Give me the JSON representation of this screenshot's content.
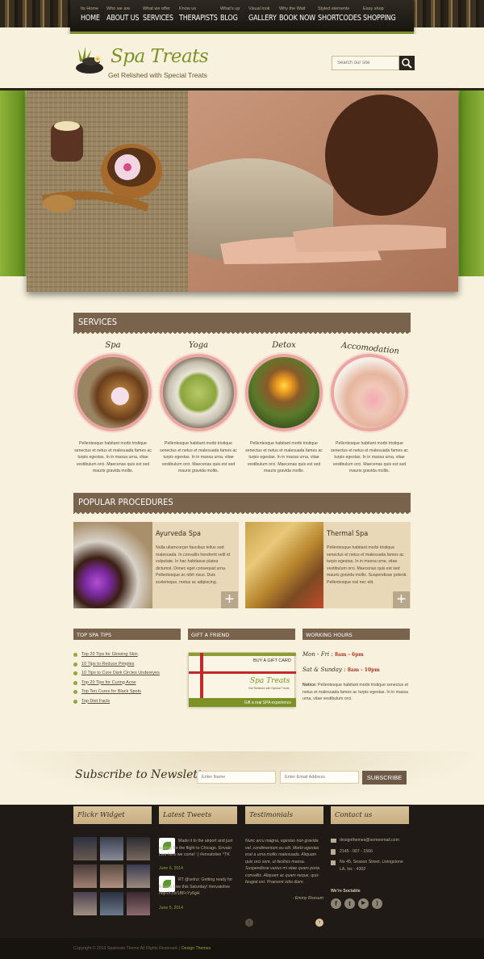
{
  "nav": [
    {
      "sub": "Its Home",
      "label": "HOME"
    },
    {
      "sub": "Who we are",
      "label": "ABOUT US"
    },
    {
      "sub": "What we offer",
      "label": "SERVICES"
    },
    {
      "sub": "Know us",
      "label": "THERAPISTS"
    },
    {
      "sub": "What's up",
      "label": "BLOG"
    },
    {
      "sub": "Visual look",
      "label": "GALLERY"
    },
    {
      "sub": "Why the Wait",
      "label": "BOOK NOW"
    },
    {
      "sub": "Styled elements",
      "label": "SHORTCODES"
    },
    {
      "sub": "Easy shop",
      "label": "SHOPPING"
    }
  ],
  "logo": {
    "title": "Spa Treats",
    "tagline": "Get Relished with Special Treats"
  },
  "search": {
    "placeholder": "Search our site"
  },
  "services": {
    "heading": "SERVICES",
    "items": [
      {
        "title": "Spa",
        "text": "Pellentesque habitant morbi tristique senectus et netus et malesuada fames ac turpis egestas. In in massa urna, vitae vestibulum orci. Maecenas quis est sed mauris gravida mollis."
      },
      {
        "title": "Yoga",
        "text": "Pellentesque habitant morbi tristique senectus et netus et malesuada fames ac turpis egestas. In in massa urna, vitae vestibulum orci. Maecenas quis est sed mauris gravida mollis."
      },
      {
        "title": "Detox",
        "text": "Pellentesque habitant morbi tristique senectus et netus et malesuada fames ac turpis egestas. In in massa urna, vitae vestibulum orci. Maecenas quis est sed mauris gravida mollis."
      },
      {
        "title": "Accomodation",
        "text": "Pellentesque habitant morbi tristique senectus et netus et malesuada fames ac turpis egestas. In in massa urna, vitae vestibulum orci. Maecenas quis est sed mauris gravida mollis."
      }
    ]
  },
  "procedures": {
    "heading": "POPULAR PROCEDURES",
    "items": [
      {
        "title": "Ayurveda Spa",
        "text": "Nulla ullamcorper faucibus tellus sed malesuada. In convallis hendrerit velit id vulputate. In hac habitasse platea dictumst. Donec eget consequat urna. Pellentesque ac nibh risus. Duis scelerisque, metus ac adipiscing."
      },
      {
        "title": "Thermal Spa",
        "text": "Pellentesque habitant morbi tristique senectus et netus et malesuada fames ac turpis egestas. In in massa urna, vitae vestibulum orci. Maecenas quis est sed mauris gravida mollis. Suspendisse potenti. Pellentesque nisl nec elit."
      }
    ]
  },
  "tips": {
    "heading": "TOP SPA TIPS",
    "items": [
      "Top 20 Tips for Glowing Skin",
      "10 Tips to Reduce Pimples",
      "10 Tips to Cure Dark Circles Undereyes",
      "Top 20 Tips for Curing Acne",
      "Top Ten Cures for Black Spots",
      "Top Diet Facts"
    ]
  },
  "gift": {
    "heading": "GIFT A FRIEND",
    "card_label": "BUY A GIFT CARD",
    "card_logo": "Spa Treats",
    "card_tag": "Get Relished with Special Treats",
    "card_footer": "Gift a real SPA experience"
  },
  "hours": {
    "heading": "WORKING HOURS",
    "weekday_label": "Mon - Fri :",
    "weekday_time": "8am - 6pm",
    "weekend_label": "Sat & Sunday :",
    "weekend_time": "8am - 10pm",
    "notice_label": "Notice:",
    "notice_text": "Pellentesque habitant morbi tristique senectus et netus et malesuada fames ac turpis egestas. In in massa urna, vitae vestibulum orci."
  },
  "newsletter": {
    "title": "Subscribe to Newsletter",
    "name_placeholder": "Enter Name",
    "email_placeholder": "Enter Email Address",
    "button": "SUBSCRIBE"
  },
  "footer": {
    "flickr": {
      "heading": "Flickr Widget"
    },
    "tweets": {
      "heading": "Latest Tweets",
      "items": [
        {
          "text": "Made it to the airport and just waiting for the flight to Chicago. Envato Live here we come! :) #envatolive ^TK",
          "date": "June 6, 2014"
        },
        {
          "text": "RT @selnz: Getting ready for Envato Live this Saturday! #envatolive http://t.co/1BFcYy6gH",
          "date": "June 5, 2014"
        }
      ]
    },
    "testimonials": {
      "heading": "Testimonials",
      "text": "Nunc arcu magna, egestas non gravida vel, condimentum eu elit. Morbi egestas erat a urna mollis malesuada. Aliquam quis orci sem, ut facilisis massa. Suspendisse varius mi vitae quam porta convallis. Aliquam ac quam neque, quis feugiat est. Praesent odio diam.",
      "author": "- Emmy Rossum"
    },
    "contact": {
      "heading": "Contact us",
      "email": "designthemes@someemail.com",
      "phone": "2145 - 007 - 1566",
      "address": "No 45, Season Street, Livingstone LA, Inc - 4302",
      "social_heading": "We're Sociable"
    }
  },
  "copyright": {
    "text": "Copyright © 2013 Spatreats Theme All Rights Reserved. |",
    "link": "Design Themes"
  },
  "colors": {
    "brand_green": "#7c9226",
    "bar_brown": "#7a634c",
    "bg_cream": "#f7f1dd",
    "footer_dark": "#1f1a15"
  }
}
